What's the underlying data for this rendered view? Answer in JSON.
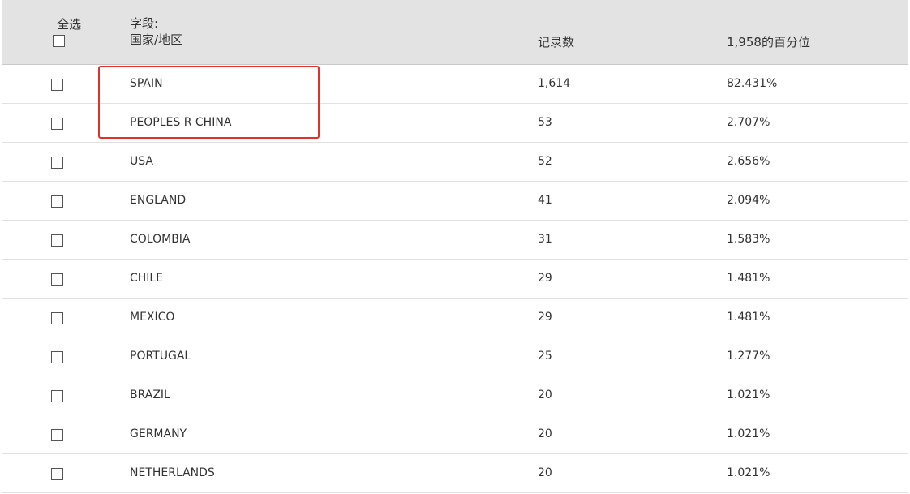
{
  "header": {
    "select_all": "全选",
    "field_label": "字段:",
    "field_name": "国家/地区",
    "count_label": "记录数",
    "percent_label": "1,958的百分位"
  },
  "rows": [
    {
      "name": "SPAIN",
      "count": "1,614",
      "percent": "82.431%"
    },
    {
      "name": "PEOPLES R CHINA",
      "count": "53",
      "percent": "2.707%"
    },
    {
      "name": "USA",
      "count": "52",
      "percent": "2.656%"
    },
    {
      "name": "ENGLAND",
      "count": "41",
      "percent": "2.094%"
    },
    {
      "name": "COLOMBIA",
      "count": "31",
      "percent": "1.583%"
    },
    {
      "name": "CHILE",
      "count": "29",
      "percent": "1.481%"
    },
    {
      "name": "MEXICO",
      "count": "29",
      "percent": "1.481%"
    },
    {
      "name": "PORTUGAL",
      "count": "25",
      "percent": "1.277%"
    },
    {
      "name": "BRAZIL",
      "count": "20",
      "percent": "1.021%"
    },
    {
      "name": "GERMANY",
      "count": "20",
      "percent": "1.021%"
    },
    {
      "name": "NETHERLANDS",
      "count": "20",
      "percent": "1.021%"
    }
  ],
  "colors": {
    "header_bg": "#e3e3e3",
    "highlight_border": "#e0322b",
    "row_divider": "#e1e1e1"
  }
}
